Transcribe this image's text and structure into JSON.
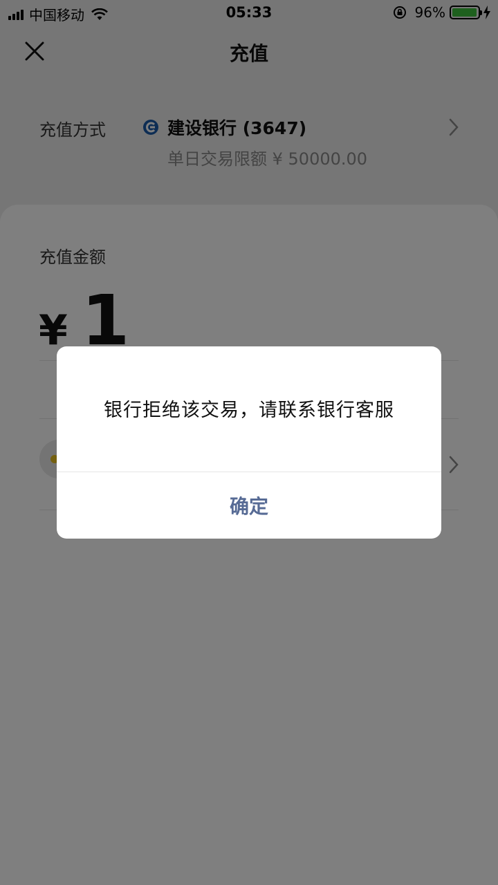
{
  "status_bar": {
    "carrier": "中国移动",
    "time": "05:33",
    "battery_percent": "96%",
    "battery_level": 0.96,
    "battery_color": "#3cc03c"
  },
  "nav": {
    "title": "充值",
    "close_icon": "close-icon"
  },
  "payment_method": {
    "label": "充值方式",
    "bank_name": "建设银行 (3647)",
    "daily_limit": "单日交易限额 ¥ 50000.00",
    "bank_logo_color": "#1a5aa8"
  },
  "amount": {
    "label": "充值金额",
    "currency": "¥",
    "value": "1"
  },
  "dialog": {
    "message": "银行拒绝该交易，请联系银行客服",
    "confirm_label": "确定",
    "confirm_color": "#576b95"
  }
}
